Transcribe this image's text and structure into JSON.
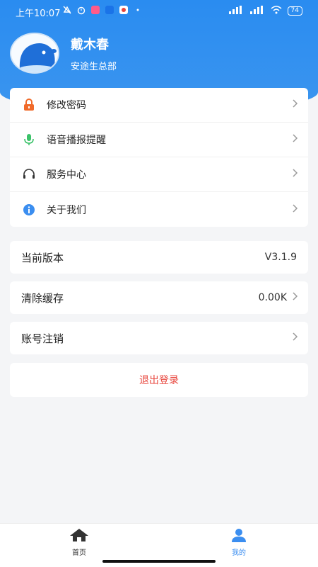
{
  "status_bar": {
    "time": "上午10:07",
    "battery": "74"
  },
  "profile": {
    "name": "戴木春",
    "department": "安途生总部"
  },
  "menu": [
    {
      "label": "修改密码",
      "icon": "lock-icon",
      "color": "#f06a2a"
    },
    {
      "label": "语音播报提醒",
      "icon": "microphone-icon",
      "color": "#3cc26a"
    },
    {
      "label": "服务中心",
      "icon": "headset-icon",
      "color": "#333333"
    },
    {
      "label": "关于我们",
      "icon": "info-icon",
      "color": "#3b8ef0"
    }
  ],
  "version": {
    "label": "当前版本",
    "value": "V3.1.9"
  },
  "cache": {
    "label": "清除缓存",
    "value": "0.00K"
  },
  "account": {
    "label": "账号注销"
  },
  "logout": {
    "label": "退出登录"
  },
  "tabs": [
    {
      "label": "首页",
      "icon": "home-icon",
      "active": false
    },
    {
      "label": "我的",
      "icon": "user-icon",
      "active": true
    }
  ],
  "colors": {
    "header": "#2a8cf0",
    "active_tab": "#3b8ef0",
    "logout": "#e8453c"
  }
}
